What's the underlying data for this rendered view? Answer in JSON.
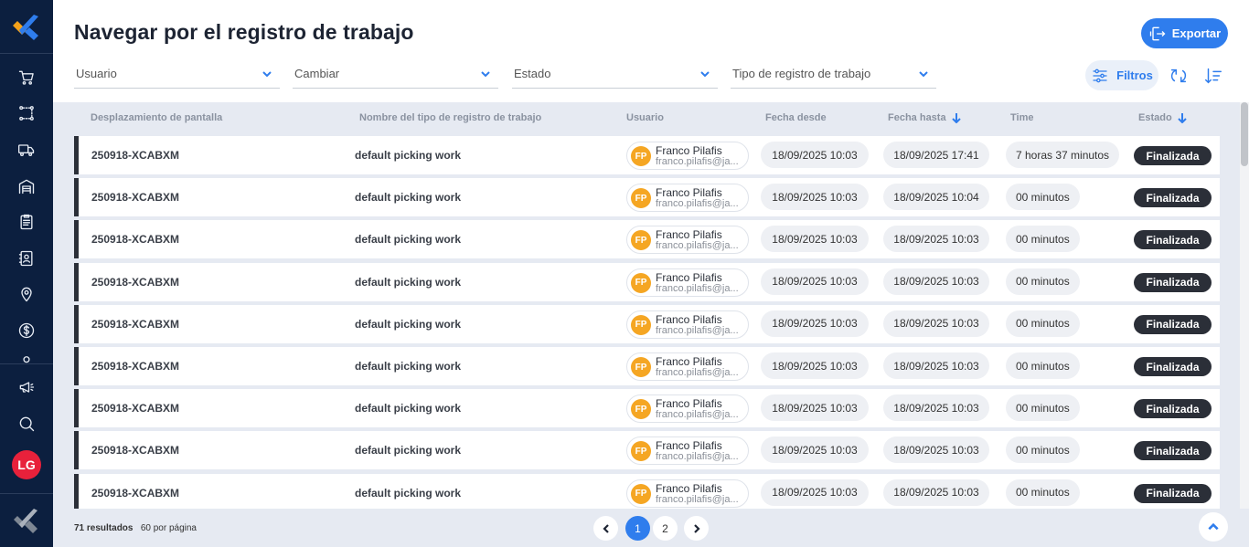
{
  "header": {
    "title": "Navegar por el registro de trabajo",
    "export_label": "Exportar"
  },
  "sidebar": {
    "items": [
      {
        "icon": "cart-icon"
      },
      {
        "icon": "route-icon"
      },
      {
        "icon": "truck-icon"
      },
      {
        "icon": "warehouse-icon"
      },
      {
        "icon": "clipboard-icon"
      },
      {
        "icon": "contact-book-icon"
      },
      {
        "icon": "map-pin-icon"
      },
      {
        "icon": "dollar-icon"
      },
      {
        "icon": "megaphone-icon"
      },
      {
        "icon": "search-icon"
      }
    ],
    "avatar_initials": "LG"
  },
  "filters": {
    "usuario": "Usuario",
    "cambiar": "Cambiar",
    "estado": "Estado",
    "tipo": "Tipo de registro de trabajo",
    "filtros_label": "Filtros"
  },
  "table": {
    "headers": {
      "desplazamiento": "Desplazamiento de pantalla",
      "tipo": "Nombre del tipo de registro de trabajo",
      "usuario": "Usuario",
      "fecha_desde": "Fecha desde",
      "fecha_hasta": "Fecha hasta",
      "time": "Time",
      "estado": "Estado"
    },
    "rows": [
      {
        "id": "250918-XCABXM",
        "type": "default picking work",
        "initials": "FP",
        "user": "Franco Pilafis",
        "email": "franco.pilafis@ja...",
        "from": "18/09/2025 10:03",
        "to": "18/09/2025 17:41",
        "time": "7 horas 37 minutos",
        "status": "Finalizada"
      },
      {
        "id": "250918-XCABXM",
        "type": "default picking work",
        "initials": "FP",
        "user": "Franco Pilafis",
        "email": "franco.pilafis@ja...",
        "from": "18/09/2025 10:03",
        "to": "18/09/2025 10:04",
        "time": "00 minutos",
        "status": "Finalizada"
      },
      {
        "id": "250918-XCABXM",
        "type": "default picking work",
        "initials": "FP",
        "user": "Franco Pilafis",
        "email": "franco.pilafis@ja...",
        "from": "18/09/2025 10:03",
        "to": "18/09/2025 10:03",
        "time": "00 minutos",
        "status": "Finalizada"
      },
      {
        "id": "250918-XCABXM",
        "type": "default picking work",
        "initials": "FP",
        "user": "Franco Pilafis",
        "email": "franco.pilafis@ja...",
        "from": "18/09/2025 10:03",
        "to": "18/09/2025 10:03",
        "time": "00 minutos",
        "status": "Finalizada"
      },
      {
        "id": "250918-XCABXM",
        "type": "default picking work",
        "initials": "FP",
        "user": "Franco Pilafis",
        "email": "franco.pilafis@ja...",
        "from": "18/09/2025 10:03",
        "to": "18/09/2025 10:03",
        "time": "00 minutos",
        "status": "Finalizada"
      },
      {
        "id": "250918-XCABXM",
        "type": "default picking work",
        "initials": "FP",
        "user": "Franco Pilafis",
        "email": "franco.pilafis@ja...",
        "from": "18/09/2025 10:03",
        "to": "18/09/2025 10:03",
        "time": "00 minutos",
        "status": "Finalizada"
      },
      {
        "id": "250918-XCABXM",
        "type": "default picking work",
        "initials": "FP",
        "user": "Franco Pilafis",
        "email": "franco.pilafis@ja...",
        "from": "18/09/2025 10:03",
        "to": "18/09/2025 10:03",
        "time": "00 minutos",
        "status": "Finalizada"
      },
      {
        "id": "250918-XCABXM",
        "type": "default picking work",
        "initials": "FP",
        "user": "Franco Pilafis",
        "email": "franco.pilafis@ja...",
        "from": "18/09/2025 10:03",
        "to": "18/09/2025 10:03",
        "time": "00 minutos",
        "status": "Finalizada"
      },
      {
        "id": "250918-XCABXM",
        "type": "default picking work",
        "initials": "FP",
        "user": "Franco Pilafis",
        "email": "franco.pilafis@ja...",
        "from": "18/09/2025 10:03",
        "to": "18/09/2025 10:03",
        "time": "00 minutos",
        "status": "Finalizada"
      }
    ]
  },
  "footer": {
    "results_count": "71 resultados",
    "per_page": "60 por página",
    "pages": [
      "1",
      "2"
    ],
    "current_page": "1"
  },
  "colors": {
    "accent": "#2f7ded",
    "sidebar": "#0c1f3f",
    "avatar": "#e8213b",
    "user_avatar": "#f5a623",
    "status_badge": "#2b2f38"
  }
}
